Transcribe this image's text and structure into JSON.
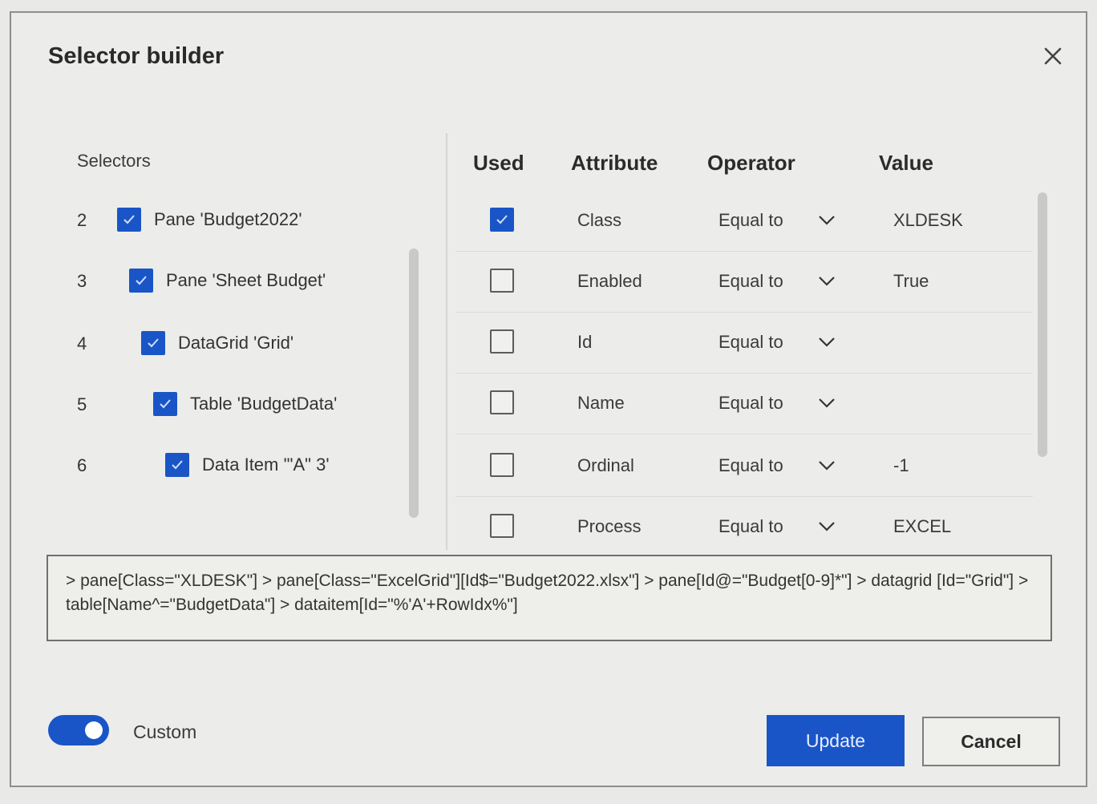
{
  "dialog": {
    "title": "Selector builder",
    "close_icon": "close-icon"
  },
  "selectors": {
    "label": "Selectors",
    "items": [
      {
        "num": "2",
        "label": "Pane 'Budget2022'",
        "checked": true
      },
      {
        "num": "3",
        "label": "Pane 'Sheet Budget'",
        "checked": true
      },
      {
        "num": "4",
        "label": "DataGrid 'Grid'",
        "checked": true
      },
      {
        "num": "5",
        "label": "Table 'BudgetData'",
        "checked": true
      },
      {
        "num": "6",
        "label": "Data Item '\"A\" 3'",
        "checked": true
      }
    ]
  },
  "attributes": {
    "headers": {
      "used": "Used",
      "attribute": "Attribute",
      "operator": "Operator",
      "value": "Value"
    },
    "rows": [
      {
        "used": true,
        "attribute": "Class",
        "operator": "Equal to",
        "value": "XLDESK"
      },
      {
        "used": false,
        "attribute": "Enabled",
        "operator": "Equal to",
        "value": "True"
      },
      {
        "used": false,
        "attribute": "Id",
        "operator": "Equal to",
        "value": ""
      },
      {
        "used": false,
        "attribute": "Name",
        "operator": "Equal to",
        "value": ""
      },
      {
        "used": false,
        "attribute": "Ordinal",
        "operator": "Equal to",
        "value": "-1"
      },
      {
        "used": false,
        "attribute": "Process",
        "operator": "Equal to",
        "value": "EXCEL"
      }
    ]
  },
  "selector_text": "> pane[Class=\"XLDESK\"] > pane[Class=\"ExcelGrid\"][Id$=\"Budget2022.xlsx\"] > pane[Id@=\"Budget[0-9]*\"] > datagrid [Id=\"Grid\"] > table[Name^=\"BudgetData\"] > dataitem[Id=\"%'A'+RowIdx%\"]",
  "footer": {
    "toggle_label": "Custom",
    "toggle_on": true,
    "update_label": "Update",
    "cancel_label": "Cancel"
  },
  "colors": {
    "accent": "#1a55c7",
    "background": "#ecedea"
  }
}
